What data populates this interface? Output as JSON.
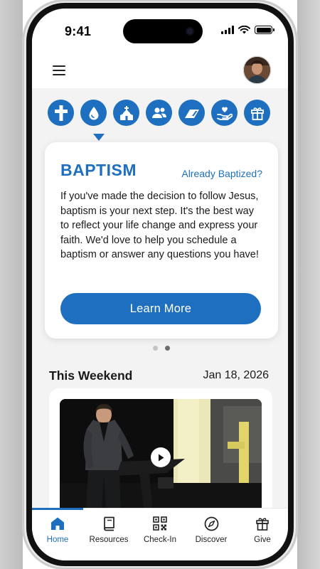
{
  "status_bar": {
    "time": "9:41"
  },
  "colors": {
    "accent": "#1e6fbf",
    "text": "#1a1a1a",
    "screen_bg": "#f3f3f3"
  },
  "header": {
    "menu_icon": "hamburger-menu-icon",
    "avatar": "user-avatar"
  },
  "quick_actions": [
    {
      "name": "cross",
      "icon": "cross-icon"
    },
    {
      "name": "baptism",
      "icon": "water-drop-icon",
      "selected": true
    },
    {
      "name": "church",
      "icon": "church-icon"
    },
    {
      "name": "groups",
      "icon": "people-icon"
    },
    {
      "name": "serve",
      "icon": "ramp-icon"
    },
    {
      "name": "care",
      "icon": "hand-heart-icon"
    },
    {
      "name": "give",
      "icon": "gift-icon"
    }
  ],
  "feature_card": {
    "title": "BAPTISM",
    "link": "Already Baptized?",
    "body": "If you've made the decision to follow Jesus, baptism is your next step. It's the best way to reflect your life change and express your faith. We'd love to help you schedule a baptism or answer any questions you have!",
    "button": "Learn More"
  },
  "carousel": {
    "pages": 2,
    "current": 2
  },
  "weekend": {
    "title": "This Weekend",
    "date": "Jan 18, 2026"
  },
  "tabs": [
    {
      "label": "Home",
      "icon": "home-icon",
      "active": true
    },
    {
      "label": "Resources",
      "icon": "book-icon"
    },
    {
      "label": "Check-In",
      "icon": "qr-code-icon"
    },
    {
      "label": "Discover",
      "icon": "compass-icon"
    },
    {
      "label": "Give",
      "icon": "gift-icon"
    }
  ]
}
